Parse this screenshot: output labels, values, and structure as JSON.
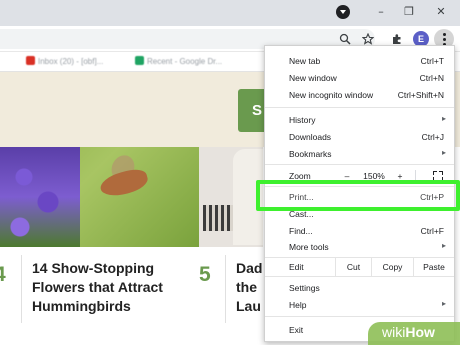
{
  "browser": {
    "avatar_letter": "E",
    "window_buttons": {
      "minimize": "–",
      "restore": "❐",
      "close": "✕"
    },
    "toolbar_icons": [
      "zoom-icon",
      "star-icon",
      "extensions-icon"
    ],
    "bookmarks": [
      {
        "label": "Inbox (20) - [obf]...",
        "favicon_color": "#d93025"
      },
      {
        "label": "Recent - Google Dr...",
        "favicon_color": "#1fa463"
      }
    ]
  },
  "page": {
    "subscribe_initial": "S",
    "articles": [
      {
        "number": "4",
        "title_lines": [
          "14 Show-Stopping",
          "Flowers that Attract",
          "Hummingbirds"
        ]
      },
      {
        "number": "5",
        "title_lines": [
          "Dad",
          "the",
          "Lau"
        ]
      }
    ]
  },
  "menu": {
    "new_tab": {
      "label": "New tab",
      "shortcut": "Ctrl+T"
    },
    "new_window": {
      "label": "New window",
      "shortcut": "Ctrl+N"
    },
    "new_incognito": {
      "label": "New incognito window",
      "shortcut": "Ctrl+Shift+N"
    },
    "history": {
      "label": "History"
    },
    "downloads": {
      "label": "Downloads",
      "shortcut": "Ctrl+J"
    },
    "bookmarks": {
      "label": "Bookmarks"
    },
    "zoom": {
      "label": "Zoom",
      "minus": "–",
      "value": "150%",
      "plus": "+"
    },
    "print": {
      "label": "Print...",
      "shortcut": "Ctrl+P"
    },
    "cast": {
      "label": "Cast..."
    },
    "find": {
      "label": "Find...",
      "shortcut": "Ctrl+F"
    },
    "more_tools": {
      "label": "More tools"
    },
    "edit": {
      "label": "Edit",
      "cut": "Cut",
      "copy": "Copy",
      "paste": "Paste"
    },
    "settings": {
      "label": "Settings"
    },
    "help": {
      "label": "Help"
    },
    "exit": {
      "label": "Exit"
    }
  },
  "highlight_color": "#3ef02e",
  "watermark": {
    "prefix": "wiki",
    "suffix": "How"
  }
}
